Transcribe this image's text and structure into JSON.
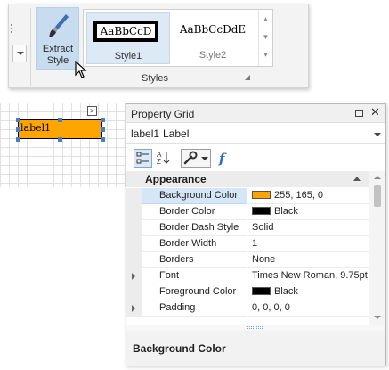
{
  "ribbon": {
    "extract_style_label": "Extract Style",
    "style_gallery": [
      {
        "sample": "AaBbCcD",
        "name": "Style1"
      },
      {
        "sample": "AaBbCcDdE",
        "name": "Style2"
      }
    ],
    "group_caption": "Styles",
    "gallery_scroll": {
      "up": "▲",
      "down": "▼",
      "more": "▾"
    }
  },
  "design_surface": {
    "label_text": "label1",
    "smart_tag": ">"
  },
  "property_grid": {
    "title": "Property Grid",
    "selected_object": {
      "name": "label1",
      "type": "Label"
    },
    "toolbar_icons": [
      "categorized-icon",
      "alphabetical-icon",
      "properties-wrench-icon",
      "dropdown-arrow-icon",
      "expression-fx-icon"
    ],
    "fx_glyph": "f",
    "category": "Appearance",
    "properties": [
      {
        "name": "Background Color",
        "value": "255, 165, 0",
        "swatch": "#ffa500",
        "expandable": false,
        "selected": true
      },
      {
        "name": "Border Color",
        "value": "Black",
        "swatch": "#000000",
        "expandable": false,
        "selected": false
      },
      {
        "name": "Border Dash Style",
        "value": "Solid",
        "swatch": null,
        "expandable": false,
        "selected": false
      },
      {
        "name": "Border Width",
        "value": "1",
        "swatch": null,
        "expandable": false,
        "selected": false
      },
      {
        "name": "Borders",
        "value": "None",
        "swatch": null,
        "expandable": false,
        "selected": false
      },
      {
        "name": "Font",
        "value": "Times New Roman, 9.75pt",
        "swatch": null,
        "expandable": true,
        "selected": false
      },
      {
        "name": "Foreground Color",
        "value": "Black",
        "swatch": "#000000",
        "expandable": false,
        "selected": false
      },
      {
        "name": "Padding",
        "value": "0, 0, 0, 0",
        "swatch": null,
        "expandable": true,
        "selected": false
      }
    ],
    "description_title": "Background Color"
  },
  "colors": {
    "accent": "#c7dcef",
    "label_background": "#ffa500",
    "fx_blue": "#2a6ad0"
  }
}
